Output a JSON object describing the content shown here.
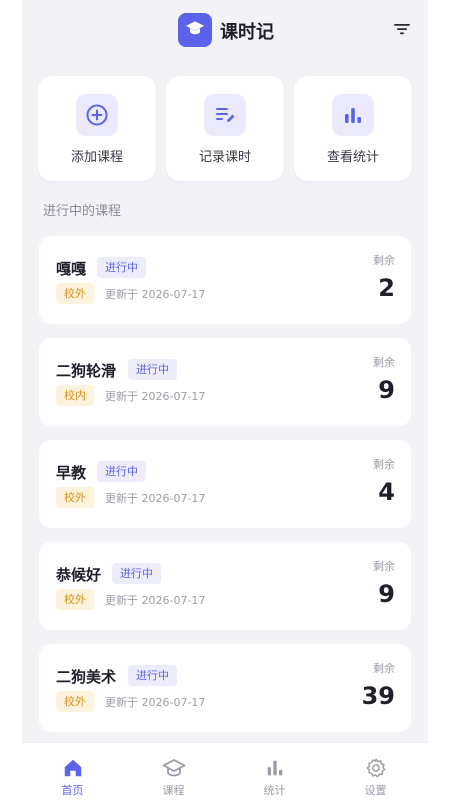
{
  "header": {
    "title": "课时记",
    "logo_icon": "graduation-cap-icon",
    "filter_icon": "filter-icon"
  },
  "actions": [
    {
      "label": "添加课程",
      "icon": "add-circle-icon"
    },
    {
      "label": "记录课时",
      "icon": "edit-list-icon"
    },
    {
      "label": "查看统计",
      "icon": "bar-chart-icon"
    }
  ],
  "section_title": "进行中的课程",
  "courses": [
    {
      "name": "嘎嘎",
      "status": "进行中",
      "location": "校外",
      "updated": "更新于 2026-07-17",
      "remain_label": "剩余",
      "remain": "2"
    },
    {
      "name": "二狗轮滑",
      "status": "进行中",
      "location": "校内",
      "updated": "更新于 2026-07-17",
      "remain_label": "剩余",
      "remain": "9"
    },
    {
      "name": "早教",
      "status": "进行中",
      "location": "校外",
      "updated": "更新于 2026-07-17",
      "remain_label": "剩余",
      "remain": "4"
    },
    {
      "name": "恭候好",
      "status": "进行中",
      "location": "校外",
      "updated": "更新于 2026-07-17",
      "remain_label": "剩余",
      "remain": "9"
    },
    {
      "name": "二狗美术",
      "status": "进行中",
      "location": "校外",
      "updated": "更新于 2026-07-17",
      "remain_label": "剩余",
      "remain": "39"
    }
  ],
  "tabs": [
    {
      "label": "首页",
      "icon": "home-icon",
      "active": true
    },
    {
      "label": "课程",
      "icon": "graduation-cap-icon",
      "active": false
    },
    {
      "label": "统计",
      "icon": "bar-chart-icon",
      "active": false
    },
    {
      "label": "设置",
      "icon": "gear-icon",
      "active": false
    }
  ],
  "colors": {
    "accent": "#5b63ea",
    "badge_bg": "#ececfb",
    "location_badge_text": "#d99118",
    "location_badge_bg": "#fdf2dc",
    "background": "#f2f2f7"
  }
}
